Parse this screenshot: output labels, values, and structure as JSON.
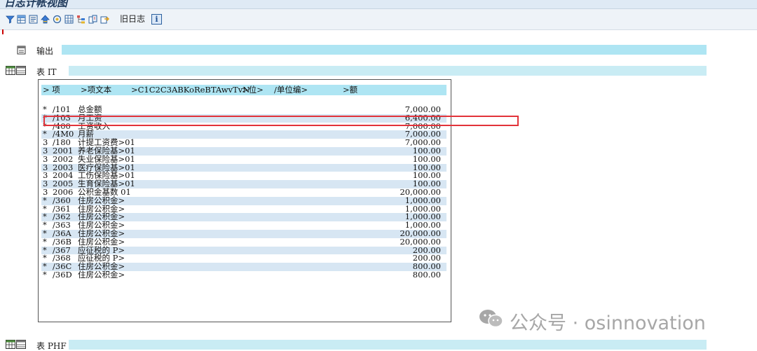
{
  "window": {
    "title": "日志计帐视图"
  },
  "toolbar": {
    "icons": [
      "filter-icon",
      "table-icon",
      "layout-icon",
      "sort-icon",
      "hierarchy-icon",
      "grid-icon",
      "tree-icon",
      "compare-icon",
      "export-icon"
    ],
    "old_log_label": "旧日志",
    "info_label": "i"
  },
  "sections": {
    "output": {
      "label": "输出"
    },
    "table_it": {
      "label": "表 IT"
    },
    "table_phf": {
      "label": "表 PHF"
    }
  },
  "table": {
    "headers": [
      ">  项",
      ">项文本",
      ">C1C2C3ABKoReBTAwvTvN",
      ">位>",
      "/单位编>",
      ">额"
    ],
    "rows": [
      {
        "a": "*",
        "b": "/101",
        "c": "总金额",
        "amt": "7,000.00"
      },
      {
        "a": "*",
        "b": "/103",
        "c": "月工资",
        "amt": "6,400.00"
      },
      {
        "a": "*",
        "b": "/400",
        "c": "工资收入",
        "amt": "7,000.00"
      },
      {
        "a": "*",
        "b": "/4M0",
        "c": "月薪",
        "amt": "7,000.00"
      },
      {
        "a": "3",
        "b": "/180",
        "c": "计提工资费>01",
        "amt": "7,000.00"
      },
      {
        "a": "3",
        "b": "2001",
        "c": "养老保险基>01",
        "amt": "100.00"
      },
      {
        "a": "3",
        "b": "2002",
        "c": "失业保险基>01",
        "amt": "100.00"
      },
      {
        "a": "3",
        "b": "2003",
        "c": "医疗保险基>01",
        "amt": "100.00"
      },
      {
        "a": "3",
        "b": "2004",
        "c": "工伤保险基>01",
        "amt": "100.00"
      },
      {
        "a": "3",
        "b": "2005",
        "c": "生育保险基>01",
        "amt": "100.00"
      },
      {
        "a": "3",
        "b": "2006",
        "c": "公积金基数 01",
        "amt": "20,000.00"
      },
      {
        "a": "*",
        "b": "/360",
        "c": "住房公积金>",
        "amt": "1,000.00"
      },
      {
        "a": "*",
        "b": "/361",
        "c": "住房公积金>",
        "amt": "1,000.00"
      },
      {
        "a": "*",
        "b": "/362",
        "c": "住房公积金>",
        "amt": "1,000.00"
      },
      {
        "a": "*",
        "b": "/363",
        "c": "住房公积金>",
        "amt": "1,000.00"
      },
      {
        "a": "*",
        "b": "/36A",
        "c": "住房公积金>",
        "amt": "20,000.00"
      },
      {
        "a": "*",
        "b": "/36B",
        "c": "住房公积金>",
        "amt": "20,000.00"
      },
      {
        "a": "*",
        "b": "/367",
        "c": "应征税的 P>",
        "amt": "200.00"
      },
      {
        "a": "*",
        "b": "/368",
        "c": "应征税的 P>",
        "amt": "200.00"
      },
      {
        "a": "*",
        "b": "/36C",
        "c": "住房公积金>",
        "amt": "800.00"
      },
      {
        "a": "*",
        "b": "/36D",
        "c": "住房公积金>",
        "amt": "800.00"
      }
    ],
    "highlighted_row": "/103"
  },
  "watermark": {
    "text": "公众号 · osinnovation"
  },
  "colors": {
    "section_bar": "#aee5f3",
    "section_bar_light": "#c9ecf4",
    "row_alt": "#d7e6f3",
    "highlight": "#e2333a",
    "toolbar_bg": "#eef3f8"
  }
}
